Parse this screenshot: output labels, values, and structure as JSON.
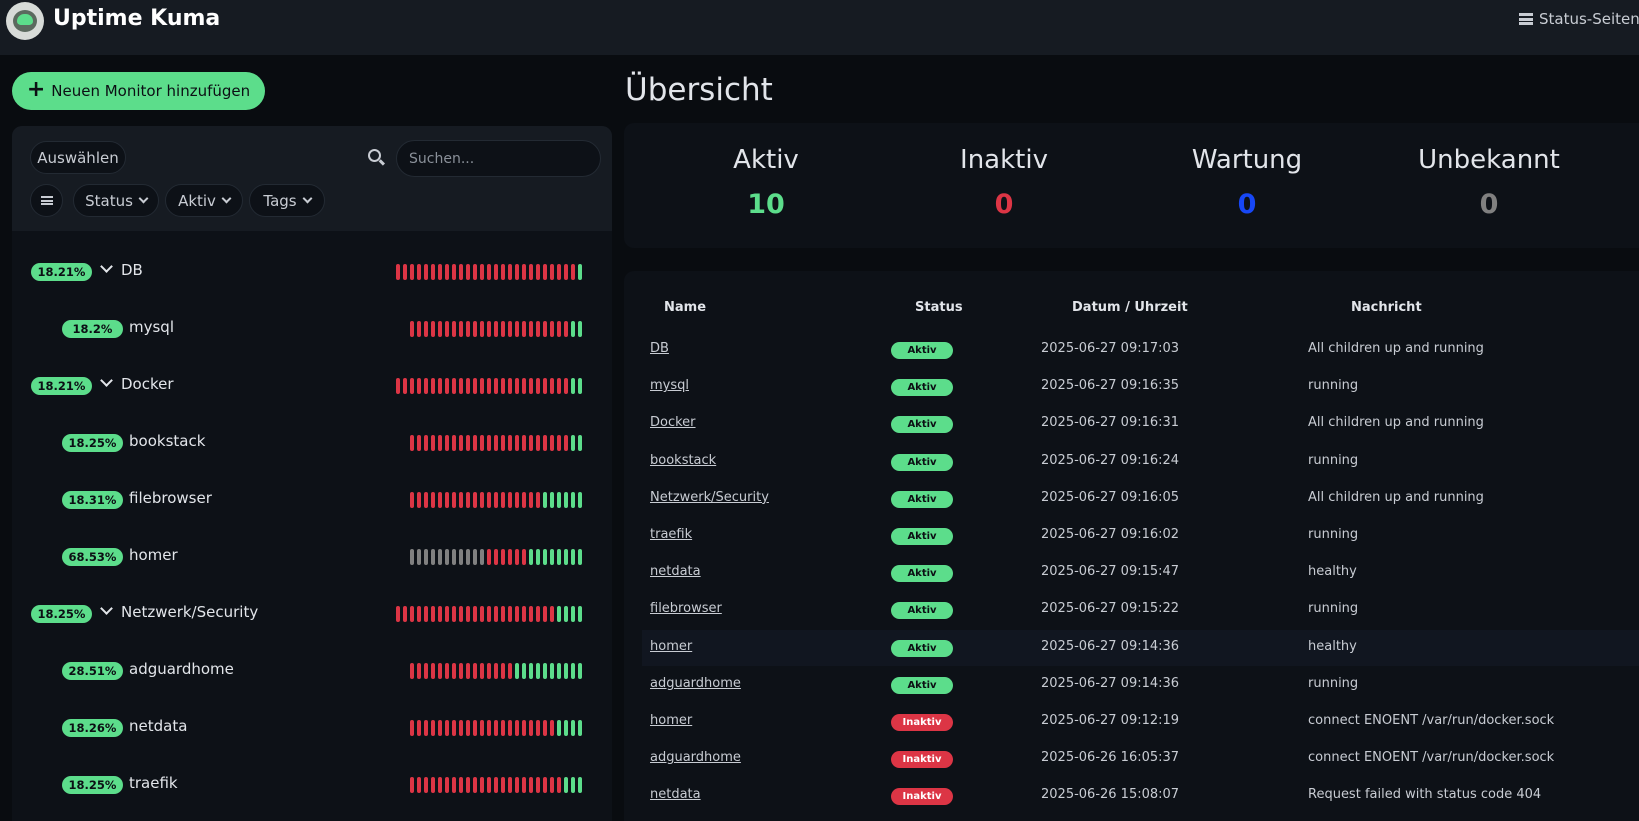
{
  "colors": {
    "green": "#5cdd8b",
    "red": "#dc3545",
    "blue": "#1747f5",
    "grey": "#808080"
  },
  "header": {
    "app_title": "Uptime Kuma",
    "status_pages": "Status-Seiten"
  },
  "sidebar": {
    "add_monitor": "Neuen Monitor hinzufügen",
    "select": "Auswählen",
    "search_placeholder": "Suchen...",
    "filters": {
      "status": "Status",
      "active": "Aktiv",
      "tags": "Tags"
    },
    "monitors": [
      {
        "uptime": "18.21%",
        "name": "DB",
        "group": true,
        "beats": "rrrrrrrrrrrrrrrrrrrrrrrrrrg"
      },
      {
        "uptime": "18.2%",
        "name": "mysql",
        "group": false,
        "beats": "rrrrrrrrrrrrrrrrrrrrrrrgg"
      },
      {
        "uptime": "18.21%",
        "name": "Docker",
        "group": true,
        "beats": "rrrrrrrrrrrrrrrrrrrrrrrrrgg"
      },
      {
        "uptime": "18.25%",
        "name": "bookstack",
        "group": false,
        "beats": "rrrrrrrrrrrrrrrrrrrrrrrgg"
      },
      {
        "uptime": "18.31%",
        "name": "filebrowser",
        "group": false,
        "beats": "rrrrrrrrrrrrrrrrrrrgggggg"
      },
      {
        "uptime": "68.53%",
        "name": "homer",
        "group": false,
        "beats": "xxxxxxxxxxxrrrrrrgggggggg"
      },
      {
        "uptime": "18.25%",
        "name": "Netzwerk/Security",
        "group": true,
        "beats": "rrrrrrrrrrrrrrrrrrrrrrrgggg"
      },
      {
        "uptime": "28.51%",
        "name": "adguardhome",
        "group": false,
        "beats": "rrrrrrrrrrrrrrrgggggggggg"
      },
      {
        "uptime": "18.26%",
        "name": "netdata",
        "group": false,
        "beats": "rrrrrrrrrrrrrrrrrrrrrgggg"
      },
      {
        "uptime": "18.25%",
        "name": "traefik",
        "group": false,
        "beats": "rrrrrrrrrrrrrrrrrrrrrrggg"
      }
    ]
  },
  "overview": {
    "title": "Übersicht",
    "stats": [
      {
        "label": "Aktiv",
        "value": "10",
        "color": "#5cdd8b"
      },
      {
        "label": "Inaktiv",
        "value": "0",
        "color": "#dc3545"
      },
      {
        "label": "Wartung",
        "value": "0",
        "color": "#1747f5"
      },
      {
        "label": "Unbekannt",
        "value": "0",
        "color": "#808080"
      }
    ]
  },
  "events": {
    "headers": {
      "name": "Name",
      "status": "Status",
      "datetime": "Datum / Uhrzeit",
      "message": "Nachricht"
    },
    "rows": [
      {
        "name": "DB",
        "status": "Aktiv",
        "up": true,
        "time": "2025-06-27 09:17:03",
        "msg": "All children up and running"
      },
      {
        "name": "mysql",
        "status": "Aktiv",
        "up": true,
        "time": "2025-06-27 09:16:35",
        "msg": "running"
      },
      {
        "name": "Docker",
        "status": "Aktiv",
        "up": true,
        "time": "2025-06-27 09:16:31",
        "msg": "All children up and running"
      },
      {
        "name": "bookstack",
        "status": "Aktiv",
        "up": true,
        "time": "2025-06-27 09:16:24",
        "msg": "running"
      },
      {
        "name": "Netzwerk/Security",
        "status": "Aktiv",
        "up": true,
        "time": "2025-06-27 09:16:05",
        "msg": "All children up and running"
      },
      {
        "name": "traefik",
        "status": "Aktiv",
        "up": true,
        "time": "2025-06-27 09:16:02",
        "msg": "running"
      },
      {
        "name": "netdata",
        "status": "Aktiv",
        "up": true,
        "time": "2025-06-27 09:15:47",
        "msg": "healthy"
      },
      {
        "name": "filebrowser",
        "status": "Aktiv",
        "up": true,
        "time": "2025-06-27 09:15:22",
        "msg": "running"
      },
      {
        "name": "homer",
        "status": "Aktiv",
        "up": true,
        "time": "2025-06-27 09:14:36",
        "msg": "healthy"
      },
      {
        "name": "adguardhome",
        "status": "Aktiv",
        "up": true,
        "time": "2025-06-27 09:14:36",
        "msg": "running"
      },
      {
        "name": "homer",
        "status": "Inaktiv",
        "up": false,
        "time": "2025-06-27 09:12:19",
        "msg": "connect ENOENT /var/run/docker.sock"
      },
      {
        "name": "adguardhome",
        "status": "Inaktiv",
        "up": false,
        "time": "2025-06-26 16:05:37",
        "msg": "connect ENOENT /var/run/docker.sock"
      },
      {
        "name": "netdata",
        "status": "Inaktiv",
        "up": false,
        "time": "2025-06-26 15:08:07",
        "msg": "Request failed with status code 404"
      }
    ]
  }
}
